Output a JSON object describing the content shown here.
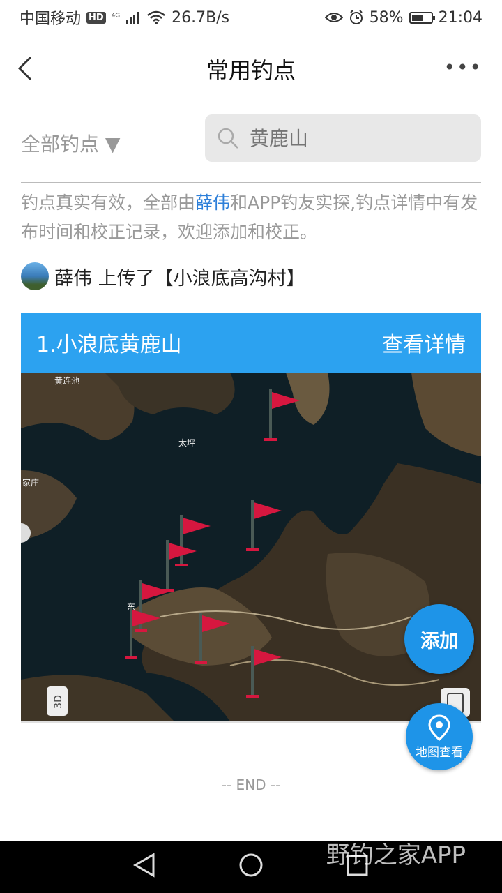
{
  "status_bar": {
    "carrier": "中国移动",
    "hd": "HD",
    "network": "⁴ᴳ",
    "speed": "26.7B/s",
    "battery": "58%",
    "battery_level": 0.58,
    "time": "21:04"
  },
  "header": {
    "title": "常用钓点",
    "more": "•••"
  },
  "filter": {
    "label": "全部钓点 ▼"
  },
  "search": {
    "placeholder": "黄鹿山"
  },
  "notice": {
    "part1": "钓点真实有效，全部由",
    "link": "薛伟",
    "part2": "和APP钓友实探,钓点详情中有发布时间和校正记录，欢迎添加和校正。"
  },
  "uploader": {
    "text": "薛伟 上传了【小浪底高沟村】"
  },
  "card": {
    "title": "1.小浪底黄鹿山",
    "details": "查看详情"
  },
  "map": {
    "labels": [
      "黄连池",
      "太坪",
      "家庄",
      "东"
    ],
    "badge_3d": "3D",
    "flag_color": "#d6173f"
  },
  "fab_add": {
    "label": "添加"
  },
  "fab_map": {
    "label": "地图查看"
  },
  "end": {
    "text": "-- END --"
  },
  "watermark": {
    "text": "野钓之家APP"
  }
}
